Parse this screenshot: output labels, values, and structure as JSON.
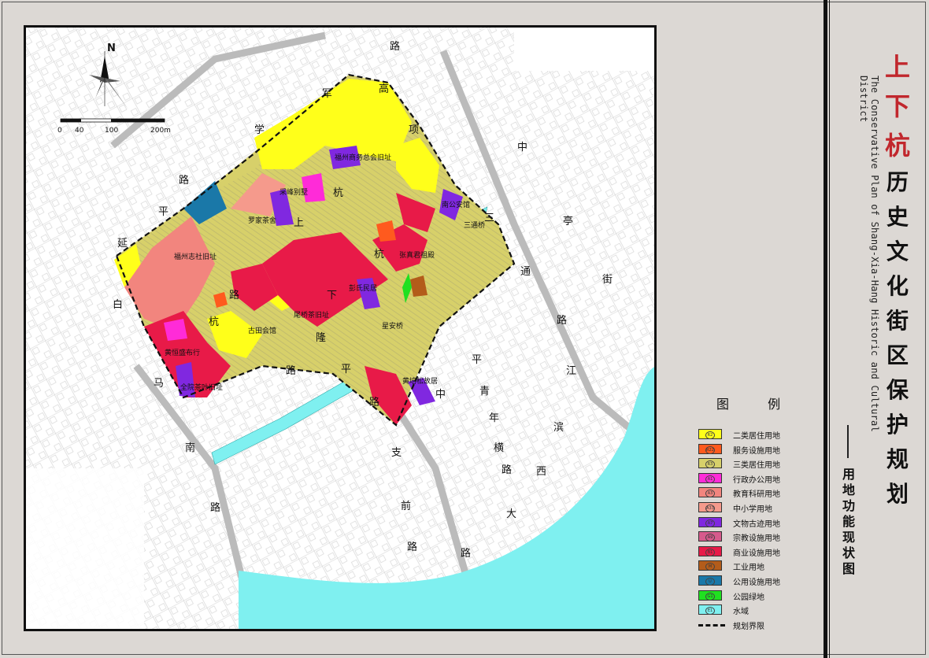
{
  "title": {
    "chinese_red": [
      "上",
      "下",
      "杭"
    ],
    "chinese_black": [
      "历",
      "史",
      "文",
      "化",
      "街",
      "区",
      "保",
      "护",
      "规",
      "划"
    ],
    "english": "The Conservative Plan of Shang-Xia-Hang Historic and Cultural District",
    "subtitle": "用地功能现状图"
  },
  "legend": {
    "title": "图 例",
    "items": [
      {
        "code": "R2",
        "label": "二类居住用地",
        "color": "#ffff1a"
      },
      {
        "code": "R22",
        "label": "服务设施用地",
        "color": "#ff5a1e"
      },
      {
        "code": "R3",
        "label": "三类居住用地",
        "color": "#d7d06a"
      },
      {
        "code": "A1",
        "label": "行政办公用地",
        "color": "#ff2bd8"
      },
      {
        "code": "A3",
        "label": "教育科研用地",
        "color": "#f2857e"
      },
      {
        "code": "A33",
        "label": "中小学用地",
        "color": "#f59a8c"
      },
      {
        "code": "A7",
        "label": "文物古迹用地",
        "color": "#8028e0"
      },
      {
        "code": "A9",
        "label": "宗教设施用地",
        "color": "#d65a8c"
      },
      {
        "code": "B1",
        "label": "商业设施用地",
        "color": "#e81a48"
      },
      {
        "code": "M",
        "label": "工业用地",
        "color": "#b35c1a"
      },
      {
        "code": "U",
        "label": "公用设施用地",
        "color": "#1a78a8"
      },
      {
        "code": "G1",
        "label": "公园绿地",
        "color": "#20e020"
      },
      {
        "code": "E1",
        "label": "水域",
        "color": "#7ff0f0"
      },
      {
        "code": "",
        "label": "规划界限",
        "color": "#111111"
      }
    ]
  },
  "scale_bar": {
    "north": "N",
    "ticks": [
      "0",
      "40",
      "100",
      "200m"
    ]
  },
  "landmarks": [
    "福州商务总会旧址",
    "采峰别墅",
    "南公安馆",
    "福州志社旧址",
    "罗家茶舍",
    "古田会馆",
    "三通桥",
    "张真君祖殿",
    "彭氏民居",
    "星安桥",
    "黄恒盛布行",
    "尾桥茶旧址",
    "全院茶叶旧址",
    "黄培松故居",
    "集康旧址"
  ],
  "roads": [
    "路",
    "军",
    "高",
    "项",
    "学",
    "路",
    "平",
    "延",
    "白",
    "马",
    "南",
    "路",
    "上",
    "杭",
    "下",
    "杭",
    "杭",
    "路",
    "隆",
    "平",
    "中",
    "亭",
    "街",
    "通",
    "路",
    "江",
    "滨",
    "西",
    "大",
    "路",
    "平",
    "青",
    "年",
    "横",
    "路",
    "路",
    "支",
    "前",
    "路",
    "路",
    "三",
    "中"
  ]
}
